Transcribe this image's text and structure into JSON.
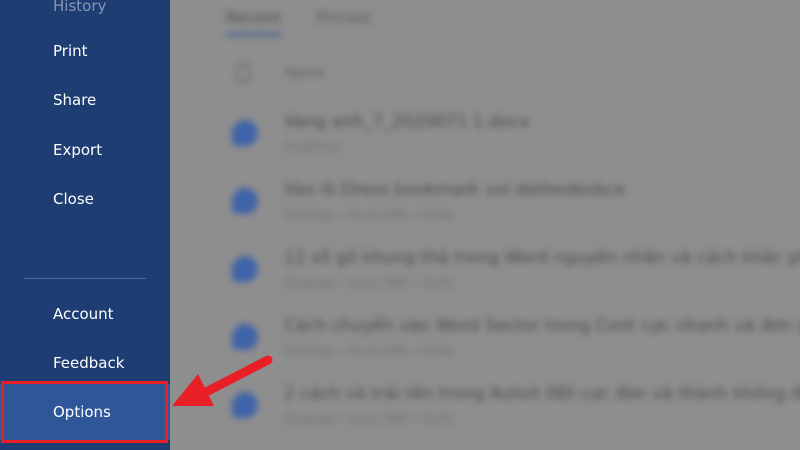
{
  "sidebar": {
    "top_item": "History",
    "items": [
      "Print",
      "Share",
      "Export",
      "Close"
    ],
    "bottom_items": [
      "Account",
      "Feedback"
    ],
    "selected_item": "Options"
  },
  "main": {
    "tabs": [
      "Recent",
      "Pinned"
    ],
    "list_header": "Name",
    "documents": [
      {
        "title": "Vang anh_7_2020071 1.docx",
        "path": "OneDrive"
      },
      {
        "title": "Vao lô Dress bookmark vol dethedesbce",
        "path": "Desktop » Excel DPA » Dullo"
      },
      {
        "title": "12 số gõ khung thả trong Word nguyên nhân và cách khắc phục",
        "path": "Desktop » Excel DPA » Dullo"
      },
      {
        "title": "Cách chuyển vào Word Sector trong Cont cực nhanh và đơn giản",
        "path": "Desktop » Excel DPA » Dullo"
      },
      {
        "title": "2 cách và trải tên trong Autoit 0ĐI cực đơn và thành không đăng",
        "path": "Desktop » Excel DPA » Dullo"
      }
    ]
  },
  "colors": {
    "sidebar_bg": "#1e3d72",
    "selected_bg": "#2f5699",
    "highlight_red": "#e81f25"
  }
}
